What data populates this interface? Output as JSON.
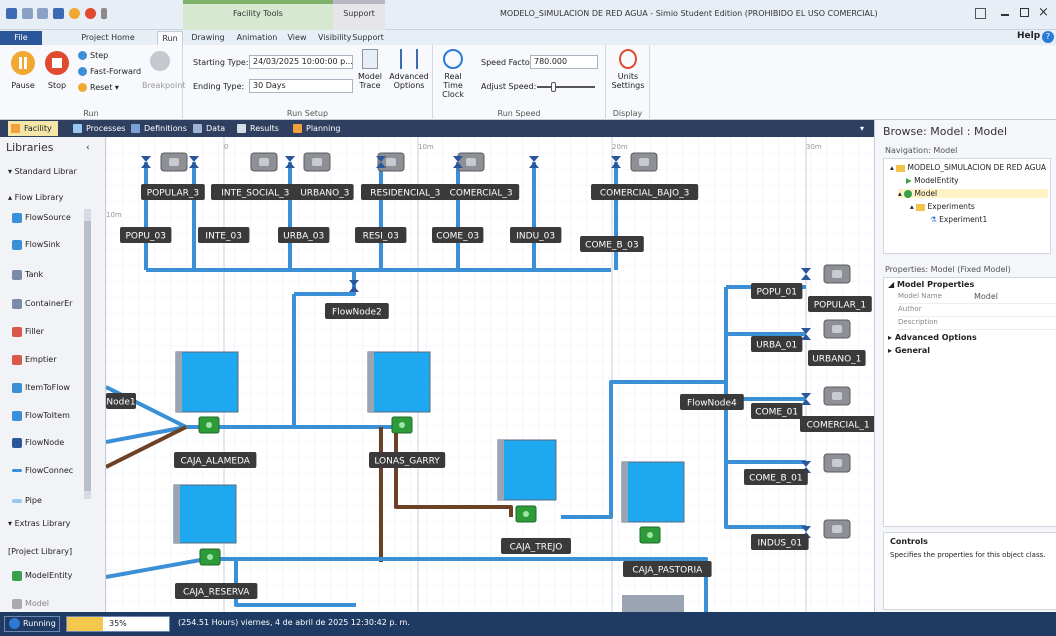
{
  "window": {
    "title": "MODELO_SIMULACION DE RED AGUA - Simio Student Edition (PROHIBIDO EL USO COMERCIAL)",
    "context_tab_facility": "Facility Tools",
    "context_tab_support": "Support",
    "help": "Help"
  },
  "ribbon_tabs": [
    "File",
    "Project Home",
    "Run",
    "Drawing",
    "Animation",
    "View",
    "Visibility",
    "Support"
  ],
  "ribbon": {
    "run_group": {
      "pause": "Pause",
      "stop": "Stop",
      "step": "Step",
      "fast_forward": "Fast-Forward",
      "reset": "Reset",
      "breakpoint": "Breakpoint",
      "label": "Run"
    },
    "setup_group": {
      "starting_type_label": "Starting Type:",
      "starting_type_value": "24/03/2025 10:00:00 p...",
      "ending_type_label": "Ending Type:",
      "ending_type_value": "30 Days",
      "model_trace": "Model Trace",
      "advanced_options": "Advanced Options",
      "label": "Run Setup"
    },
    "speed_group": {
      "real_time_clock": "Real Time Clock",
      "speed_factor_label": "Speed Factor:",
      "speed_factor_value": "780.000",
      "adjust_speed_label": "Adjust Speed:",
      "label": "Run Speed"
    },
    "display_group": {
      "units_settings": "Units Settings",
      "label": "Display"
    }
  },
  "doc_tabs": [
    "Facility",
    "Processes",
    "Definitions",
    "Data",
    "Results",
    "Planning"
  ],
  "libraries": {
    "title": "Libraries",
    "standard": "Standard Librar",
    "flow_library": "Flow Library",
    "items": [
      "FlowSource",
      "FlowSink",
      "Tank",
      "ContainerEr",
      "Filler",
      "Emptier",
      "ItemToFlow",
      "FlowToItem",
      "FlowNode",
      "FlowConnec",
      "Pipe"
    ],
    "extras": "Extras Library",
    "project_library": "[Project Library]",
    "project_items": [
      "ModelEntity",
      "Model"
    ]
  },
  "canvas": {
    "ruler": [
      "0",
      "10m",
      "20m",
      "30m",
      "10m"
    ],
    "sinks_top": [
      "POPULAR_3",
      "INTE_SOCIAL_3",
      "URBANO_3",
      "RESIDENCIAL_3",
      "COMERCIAL_3",
      "COMERCIAL_BAJO_3"
    ],
    "nodes_top": [
      "POPU_03",
      "INTE_03",
      "URBA_03",
      "RESI_03",
      "COME_03",
      "INDU_03",
      "COME_B_03"
    ],
    "flow_node2": "FlowNode2",
    "flow_node4": "FlowNode4",
    "node1": "Node1",
    "tanks": [
      "CAJA_ALAMEDA",
      "LONAS_GARRY",
      "CAJA_TREJO",
      "CAJA_RESERVA",
      "CAJA_PASTORIA"
    ],
    "nodes_right": [
      "POPU_01",
      "URBA_01",
      "COME_01",
      "COME_B_01",
      "INDUS_01"
    ],
    "sinks_right": [
      "POPULAR_1",
      "URBANO_1",
      "COMERCIAL_1"
    ]
  },
  "browse": {
    "title": "Browse: Model : Model",
    "navigation_label": "Navigation: Model",
    "tree": [
      "MODELO_SIMULACION DE RED AGUA",
      "ModelEntity",
      "Model",
      "Experiments",
      "Experiment1"
    ]
  },
  "properties": {
    "header": "Properties: Model (Fixed Model)",
    "model_properties": "Model Properties",
    "rows": [
      {
        "k": "Model Name",
        "v": "Model"
      },
      {
        "k": "Author",
        "v": ""
      },
      {
        "k": "Description",
        "v": ""
      }
    ],
    "advanced_options": "Advanced Options",
    "general": "General"
  },
  "controls": {
    "title": "Controls",
    "description": "Specifies the properties for this object class."
  },
  "status": {
    "state": "Running",
    "progress_pct": 35,
    "progress_label": "35%",
    "time": "(254.51 Hours) viernes, 4 de abril de 2025 12:30:42 p. m."
  },
  "colors": {
    "accent": "#2b579a",
    "pipe_blue": "#3b8fd6",
    "pipe_brown": "#6b4226",
    "tank_blue": "#1ea8f0",
    "label_bg": "#3a3a3a"
  }
}
